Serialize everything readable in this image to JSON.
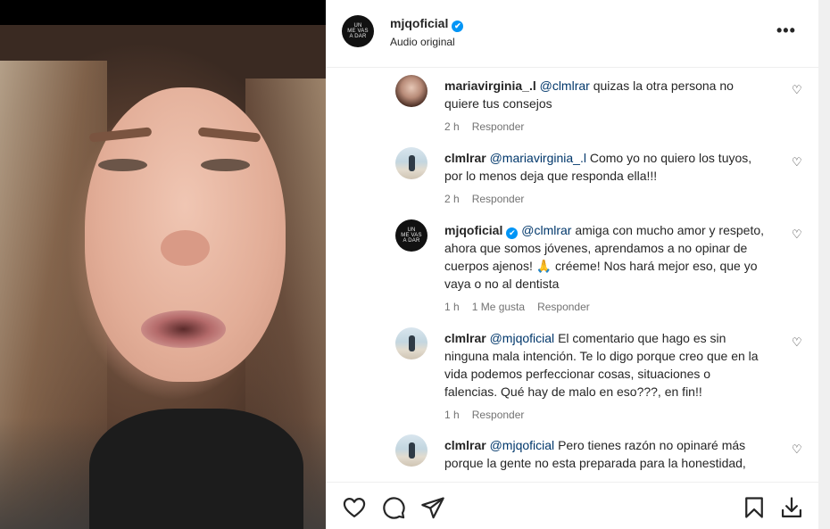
{
  "post": {
    "username": "mjqoficial",
    "subtitle": "Audio original",
    "brand_avatar_lines": [
      "UN",
      "ME VAS",
      "A DAR"
    ]
  },
  "comments": [
    {
      "username": "mariavirginia_.l",
      "mention": "@clmlrar",
      "text": "quizas la otra persona no quiere tus consejos",
      "time": "2 h",
      "likes": "",
      "reply": "Responder",
      "verified": false,
      "avatar": "girl-avatar"
    },
    {
      "username": "clmlrar",
      "mention": "@mariavirginia_.l",
      "text": "Como yo no quiero los tuyos, por lo menos deja que responda ella!!!",
      "time": "2 h",
      "likes": "",
      "reply": "Responder",
      "verified": false,
      "avatar": "beach-avatar"
    },
    {
      "username": "mjqoficial",
      "mention": "@clmlrar",
      "text": "amiga con mucho amor y respeto, ahora que somos jóvenes, aprendamos a no opinar de cuerpos ajenos! 🙏 créeme! Nos hará mejor eso, que yo vaya o no al dentista",
      "time": "1 h",
      "likes": "1 Me gusta",
      "reply": "Responder",
      "verified": true,
      "avatar": "brand-avatar"
    },
    {
      "username": "clmlrar",
      "mention": "@mjqoficial",
      "text": "El comentario que hago es sin ninguna mala intención. Te lo digo porque creo que en la vida podemos perfeccionar cosas, situaciones o falencias. Qué hay de malo en eso???, en fin!!",
      "time": "1 h",
      "likes": "",
      "reply": "Responder",
      "verified": false,
      "avatar": "beach-avatar"
    },
    {
      "username": "clmlrar",
      "mention": "@mjqoficial",
      "text": "Pero tienes razón no opinaré más porque la gente no esta preparada para la honestidad,",
      "time": "",
      "likes": "",
      "reply": "",
      "verified": false,
      "avatar": "beach-avatar"
    }
  ],
  "icons": {
    "verified": "✔",
    "more": "•••",
    "like_small": "♡"
  },
  "colors": {
    "verified_blue": "#0095f6",
    "mention_blue": "#00376b",
    "meta_gray": "#737373",
    "text": "#262626"
  }
}
